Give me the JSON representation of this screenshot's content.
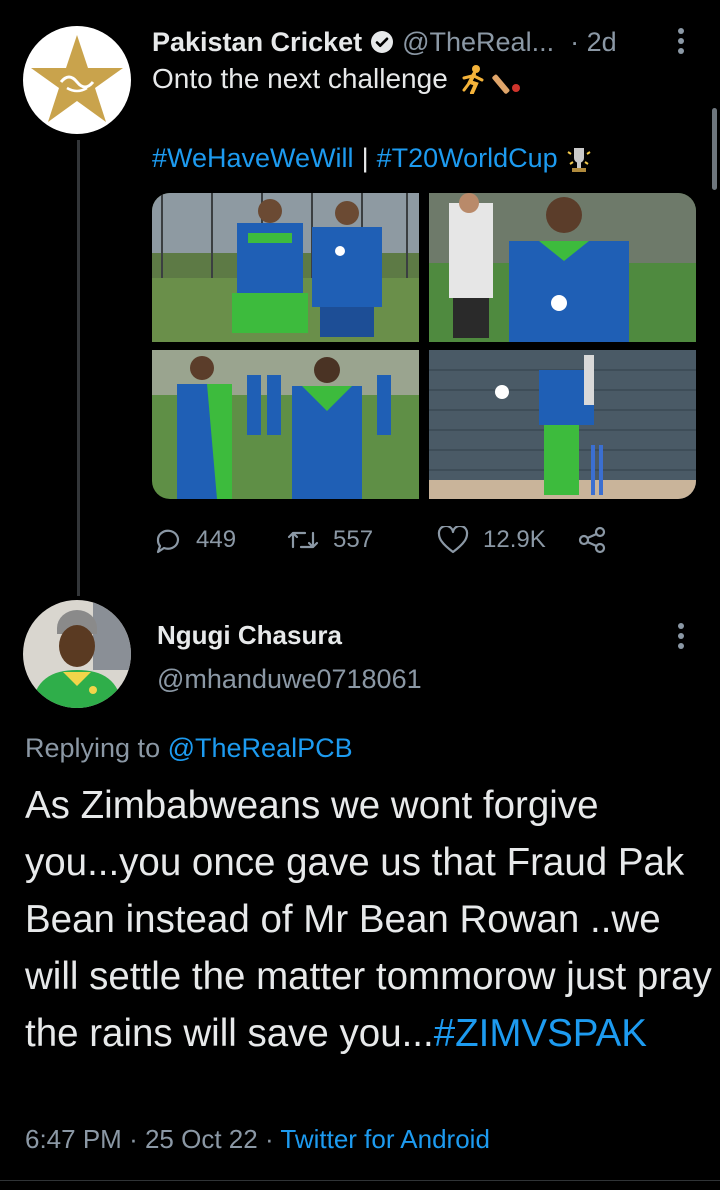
{
  "tweet": {
    "author_name": "Pakistan Cricket",
    "handle": "@TheReal...",
    "dot": "·",
    "time": "2d",
    "text": "Onto the next challenge",
    "hashtag1": "#WeHaveWeWill",
    "separator": "|",
    "hashtag2": "#T20WorldCup",
    "replies": "449",
    "retweets": "557",
    "likes": "12.9K",
    "icons": [
      "verified-badge",
      "runner-emoji",
      "cricket-bat-emoji",
      "trophy-emoji",
      "reply-icon",
      "retweet-icon",
      "like-icon",
      "share-icon",
      "more-icon"
    ]
  },
  "reply": {
    "author_name": "Ngugi Chasura",
    "handle": "@mhanduwe0718061",
    "replying_prefix": "Replying to",
    "replying_handle": "@TheRealPCB",
    "body_text": "As Zimbabweans we wont forgive you...you once gave us that Fraud Pak Bean instead of Mr Bean Rowan ..we will settle the matter tommorow just pray the rains will save you...",
    "body_hashtag": "#ZIMVSPAK",
    "time": "6:47 PM",
    "date": "25 Oct 22",
    "source": "Twitter for Android",
    "dot": "·"
  },
  "colors": {
    "link": "#1d9bf0",
    "muted": "#8b98a5",
    "text": "#e7e9ea",
    "pcb_gold": "#c9a34c",
    "kit_green": "#3dbb3d",
    "kit_blue": "#1f5fb5"
  }
}
